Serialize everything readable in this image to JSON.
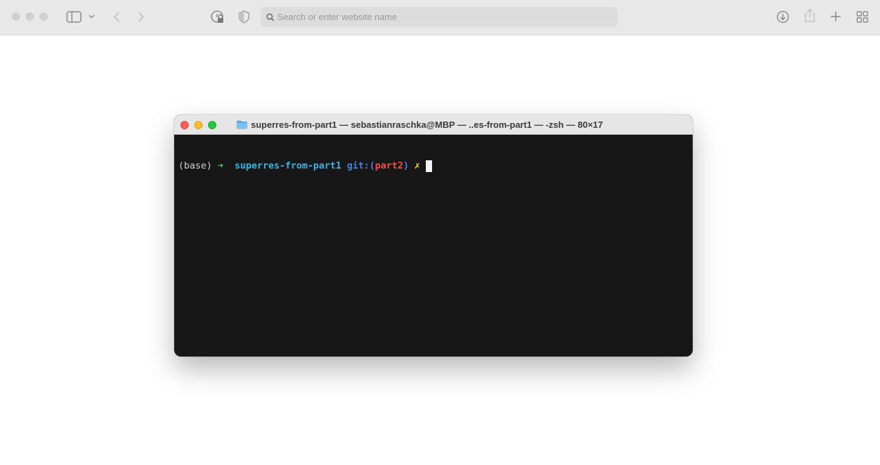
{
  "browser": {
    "address_placeholder": "Search or enter website name",
    "icons": {
      "sidebar": "sidebar-icon",
      "chevron": "chevron-down-icon",
      "back": "back-arrow-icon",
      "forward": "forward-arrow-icon",
      "privacy": "privacy-report-icon",
      "shield": "shield-icon",
      "search": "search-icon",
      "download": "download-icon",
      "share": "share-icon",
      "new_tab": "plus-icon",
      "tab_overview": "tab-overview-icon"
    }
  },
  "terminal": {
    "title": "superres-from-part1 — sebastianraschka@MBP — ..es-from-part1 — -zsh — 80×17",
    "prompt": {
      "env": "(base)",
      "arrow": "➜",
      "directory": "superres-from-part1",
      "git_prefix": "git:(",
      "branch": "part2",
      "git_suffix": ")",
      "dirty_marker": "✗"
    },
    "colors": {
      "background": "#171717",
      "arrow": "#3ddc5a",
      "directory": "#37b6e6",
      "git": "#4a7fe6",
      "branch": "#ff4a4a",
      "dirty": "#f0e040"
    }
  }
}
